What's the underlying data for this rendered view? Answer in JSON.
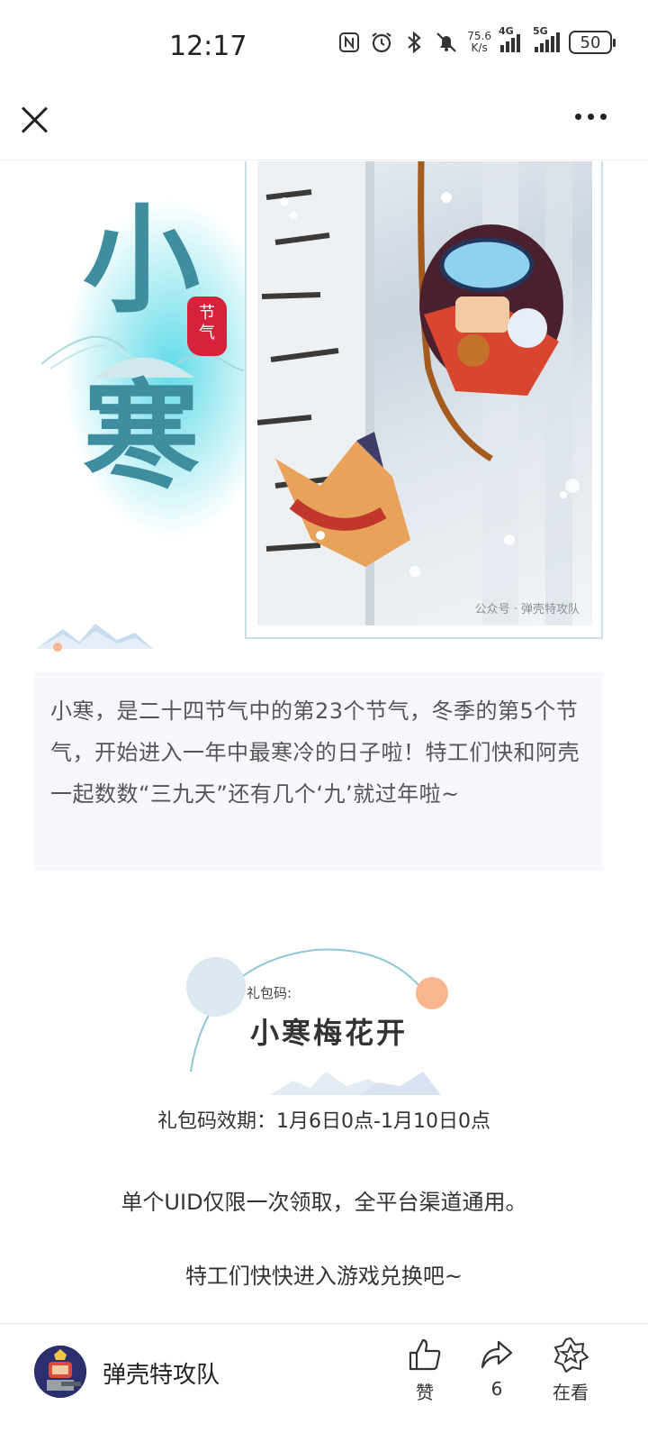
{
  "status_bar": {
    "time": "12:17",
    "net_speed_value": "75.6",
    "net_speed_unit": "K/s",
    "sim1_tag": "4G",
    "sim2_tag": "5G",
    "battery": "50",
    "icons": [
      "nfc-icon",
      "alarm-icon",
      "bluetooth-icon",
      "mute-icon",
      "signal-icon",
      "battery-icon"
    ]
  },
  "nav": {
    "close_icon": "close-icon",
    "more_icon": "more-icon"
  },
  "hero": {
    "title_char_1": "小",
    "title_char_2": "寒",
    "seal_text": "节气",
    "watermark": "公众号 · 弹壳特攻队"
  },
  "intro": {
    "text": "小寒，是二十四节气中的第23个节气，冬季的第5个节气，开始进入一年中最寒冷的日子啦！特工们快和阿壳一起数数“三九天”还有几个‘九’就过年啦~"
  },
  "gift": {
    "label": "礼包码:",
    "code": "小寒梅花开",
    "validity": "礼包码效期：1月6日0点-1月10日0点",
    "uid_note": "单个UID仅限一次领取，全平台渠道通用。",
    "cta": "特工们快快进入游戏兑换吧~"
  },
  "bottom_bar": {
    "account_name": "弹壳特攻队",
    "like_label": "赞",
    "share_count": "6",
    "seen_label": "在看"
  },
  "colors": {
    "title_teal": "#3f8ea0",
    "seal_red": "#d6233b",
    "glow_cyan": "#50d7e6",
    "intro_bg": "#f7f8fd",
    "accent_orange": "#fbb58e"
  }
}
